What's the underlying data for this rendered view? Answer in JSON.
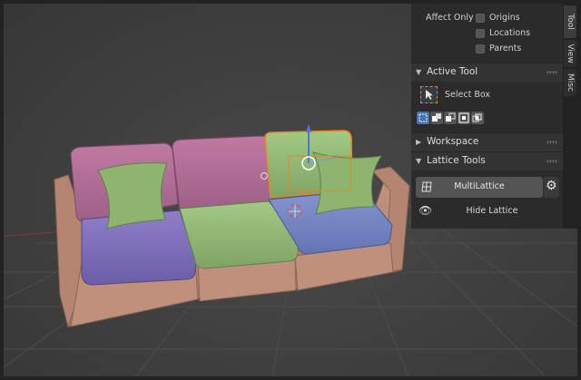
{
  "n_panel": {
    "affect_only": {
      "label": "Affect Only",
      "options": [
        {
          "label": "Origins",
          "checked": false
        },
        {
          "label": "Locations",
          "checked": false
        },
        {
          "label": "Parents",
          "checked": false
        }
      ]
    },
    "active_tool": {
      "header": "Active Tool",
      "tool_label": "Select Box",
      "select_modes": [
        "select-new-icon",
        "select-extend-icon",
        "select-subtract-icon",
        "select-invert-icon",
        "select-intersect-icon"
      ]
    },
    "workspace": {
      "header": "Workspace"
    },
    "lattice_tools": {
      "header": "Lattice Tools",
      "multilattice_label": "MultiLattice",
      "hide_lattice_label": "Hide Lattice"
    }
  },
  "tabs": [
    "Tool",
    "View",
    "Misc"
  ],
  "active_tab": "Tool",
  "colors": {
    "viewport_bg": "#404040",
    "panel_bg": "#2b2b2b",
    "selection_orange": "#e8871e",
    "select_box_blue": "#4772b3",
    "sofa_frame": "#b98a74",
    "cushion_pink": "#b06d94",
    "cushion_green": "#8db56f",
    "cushion_purple": "#7e6fb8",
    "cushion_blue": "#7285c4"
  }
}
